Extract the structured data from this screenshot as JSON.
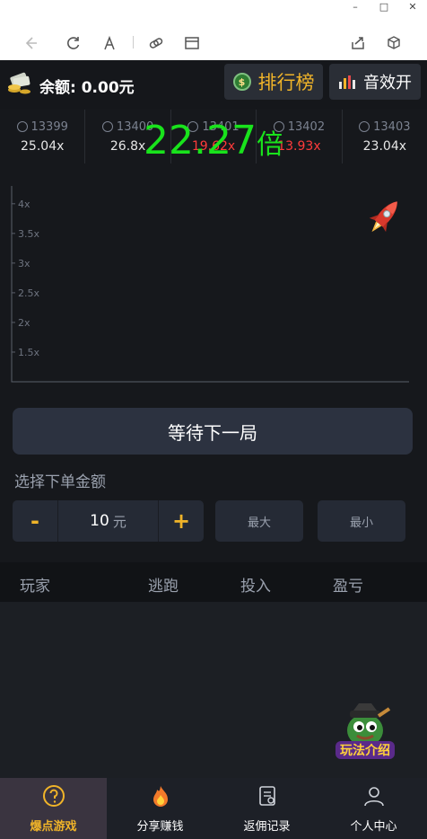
{
  "window": {
    "minimize": "–",
    "maximize": "□",
    "close": "✕"
  },
  "balance": {
    "text": "余额: 0.00元"
  },
  "buttons": {
    "rank": "排行榜",
    "rank_coin": "$",
    "sound": "音效开"
  },
  "history": [
    {
      "round": "13399",
      "mult": "25.04x",
      "color": "#e6e6e6"
    },
    {
      "round": "13400",
      "mult": "26.8x",
      "color": "#e6e6e6"
    },
    {
      "round": "13401",
      "mult": "19.62x",
      "color": "#ff3b3b"
    },
    {
      "round": "13402",
      "mult": "13.93x",
      "color": "#ff3b3b"
    },
    {
      "round": "13403",
      "mult": "23.04x",
      "color": "#e6e6e6"
    }
  ],
  "chart_data": {
    "type": "line",
    "yticks": [
      "1.5x",
      "2x",
      "2.5x",
      "3x",
      "3.5x",
      "4x"
    ],
    "ytick_values": [
      1.5,
      2,
      2.5,
      3,
      3.5,
      4
    ],
    "ylim": [
      1.0,
      4.3
    ],
    "series": []
  },
  "multiplier": {
    "value": "22.27",
    "unit": "倍"
  },
  "wait_button": "等待下一局",
  "bet": {
    "title": "选择下单金额",
    "minus": "-",
    "plus": "+",
    "value": "10",
    "unit": "元",
    "max": "最大",
    "min": "最小"
  },
  "players": {
    "col_player": "玩家",
    "col_escape": "逃跑",
    "col_bet": "投入",
    "col_profit": "盈亏"
  },
  "guide_label": "玩法介绍",
  "nav": [
    {
      "label": "爆点游戏",
      "icon": "help-circle-icon",
      "active": true
    },
    {
      "label": "分享赚钱",
      "icon": "fire-icon",
      "active": false
    },
    {
      "label": "返佣记录",
      "icon": "document-icon",
      "active": false
    },
    {
      "label": "个人中心",
      "icon": "user-icon",
      "active": false
    }
  ],
  "colors": {
    "accent": "#f0b429",
    "green": "#19e31c",
    "red": "#ff3b3b",
    "bg": "#16181c"
  }
}
